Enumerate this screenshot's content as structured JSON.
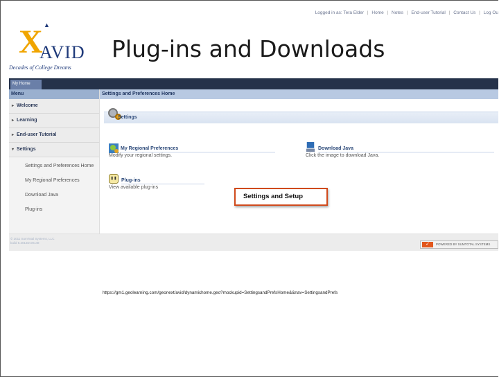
{
  "logo": {
    "brand": "AVID",
    "tagline": "Decades of College Dreams"
  },
  "title": "Plug-ins and Downloads",
  "top_links": {
    "logged_in": "Logged in as: Tera Elder",
    "links": [
      "Home",
      "Notes",
      "End-user Tutorial",
      "Contact Us",
      "Log Ou"
    ]
  },
  "nav": {
    "tab": "My Home"
  },
  "sidebar": {
    "heading": "Menu",
    "items": [
      {
        "label": "Welcome",
        "arrow": "▸"
      },
      {
        "label": "Learning",
        "arrow": "▸"
      },
      {
        "label": "End-user Tutorial",
        "arrow": "▸"
      },
      {
        "label": "Settings",
        "arrow": "▾"
      }
    ],
    "subitems": [
      "Settings and Preferences Home",
      "My Regional Preferences",
      "Download Java",
      "Plug-ins"
    ]
  },
  "content": {
    "breadcrumb": "Settings and Preferences Home",
    "section": "Settings",
    "items": [
      {
        "title": "My Regional Preferences",
        "desc": "Modify your regional settings.",
        "icon": "globe-settings-icon"
      },
      {
        "title": "Download Java",
        "desc": "Click the image to download Java.",
        "icon": "java-download-icon"
      },
      {
        "title": "Plug-ins",
        "desc": "View available plug-ins",
        "icon": "plug-icon"
      }
    ]
  },
  "callout": "Settings and Setup",
  "footer": {
    "copyright": "© 2011 SumTotal Systems, LLC",
    "build": "build 5.2013D.00148",
    "badge": "POWERED BY SUMTOTAL SYSTEMS",
    "badge_mark": "✓"
  },
  "url": "https://gm1.geolearning.com/geonext/avid/dynamichome.geo?mockupid=SettingsandPrefsHome&&nav=SettingsandPrefs",
  "colors": {
    "navbar": "#25324a",
    "accent": "#e2571c",
    "logo_gold": "#f0a500",
    "logo_blue": "#1f3a7a"
  }
}
